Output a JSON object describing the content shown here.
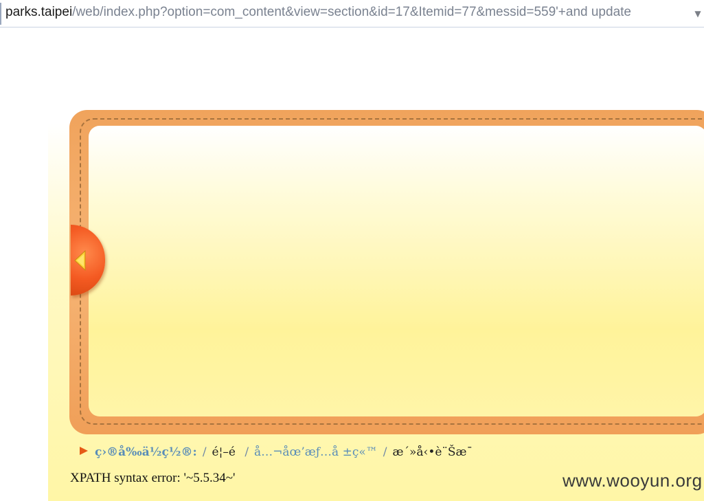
{
  "address_bar": {
    "host": "parks.taipei",
    "path": "/web/index.php?option=com_content&view=section&id=17&Itemid=77&messid=559'+and update",
    "dropdown_icon": "chevron-down-icon"
  },
  "slider": {
    "prev_icon": "triangle-left-icon",
    "frame_color": "#f2a560",
    "button_color": "#f25a22"
  },
  "breadcrumb": {
    "arrow_icon": "triangle-right-icon",
    "label": "ç›®å‰ä½ç½®:",
    "separator": "/",
    "items": [
      "é¦–é ",
      "å…¬åœ’æƒ…å ±ç«™",
      "æ´»å‹•è¨Šæ¯"
    ]
  },
  "error_message": "XPATH syntax error: '~5.5.34~'",
  "watermark": "www.wooyun.org"
}
